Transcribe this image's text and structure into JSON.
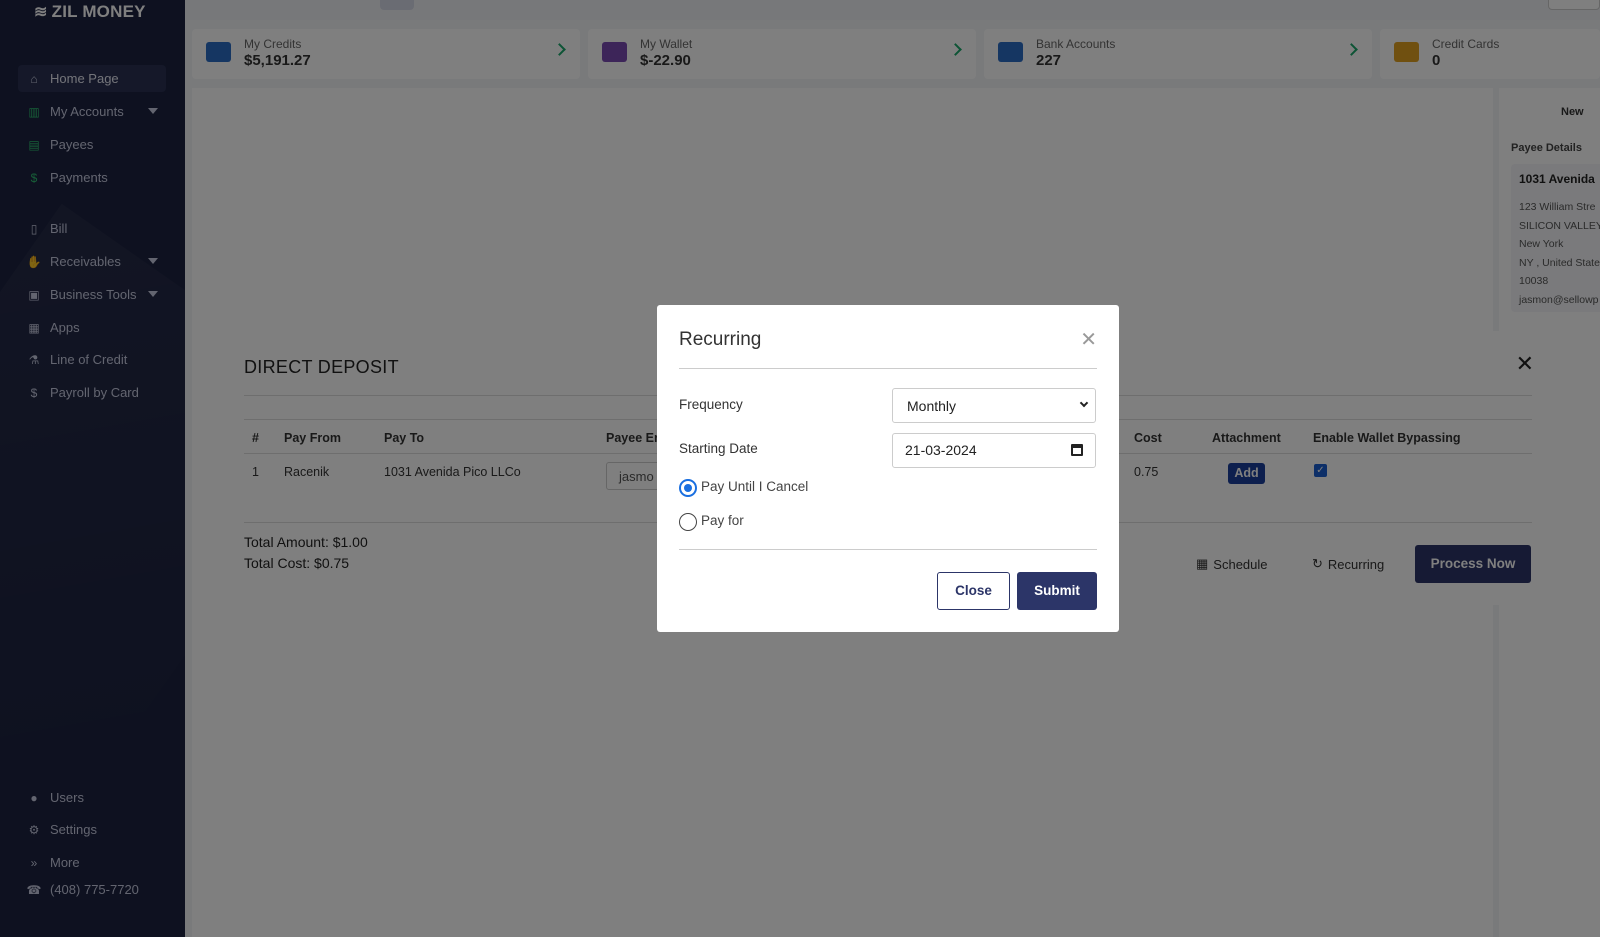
{
  "brand": {
    "name": "ZIL MONEY"
  },
  "sidebar": {
    "items": [
      {
        "label": "Home Page",
        "icon": "home-icon"
      },
      {
        "label": "My Accounts",
        "icon": "bank-icon"
      },
      {
        "label": "Payees",
        "icon": "contact-book-icon"
      },
      {
        "label": "Payments",
        "icon": "dollar-icon"
      },
      {
        "label": "Bill",
        "icon": "bill-icon"
      },
      {
        "label": "Receivables",
        "icon": "hand-coin-icon"
      },
      {
        "label": "Business Tools",
        "icon": "briefcase-icon"
      },
      {
        "label": "Apps",
        "icon": "grid-icon"
      },
      {
        "label": "Line of Credit",
        "icon": "flask-icon"
      },
      {
        "label": "Payroll by Card",
        "icon": "dollar-icon"
      }
    ],
    "bottom": [
      {
        "label": "Users",
        "icon": "user-icon"
      },
      {
        "label": "Settings",
        "icon": "gear-icon"
      },
      {
        "label": "More",
        "icon": "double-chevron-icon"
      },
      {
        "label": "(408) 775-7720",
        "icon": "phone-icon"
      }
    ]
  },
  "cards": [
    {
      "label": "My Credits",
      "value": "$5,191.27",
      "color": "#2b6cc4"
    },
    {
      "label": "My Wallet",
      "value": "$-22.90",
      "color": "#7b4bb3"
    },
    {
      "label": "Bank Accounts",
      "value": "227",
      "color": "#2b6cc4"
    },
    {
      "label": "Credit Cards",
      "value": "0",
      "color": "#e0a020"
    }
  ],
  "right_pane": {
    "new_label": "New",
    "title": "Payee Details",
    "name": "1031 Avenida",
    "lines": [
      "123 William Stre",
      "SILICON VALLEY",
      "New York",
      "NY , United State",
      "10038",
      "jasmon@sellowp"
    ]
  },
  "direct_deposit": {
    "title": "DIRECT DEPOSIT",
    "columns": [
      "#",
      "Pay From",
      "Pay To",
      "Payee Er",
      "Cost",
      "Attachment",
      "Enable Wallet Bypassing"
    ],
    "row": {
      "num": "1",
      "pay_from": "Racenik",
      "pay_to": "1031 Avenida Pico LLCo",
      "payee_email": "jasmo",
      "cost": "0.75",
      "attachment_button": "Add"
    },
    "total_amount": "Total Amount: $1.00",
    "total_cost": "Total Cost: $0.75",
    "schedule_label": "Schedule",
    "recurring_label": "Recurring",
    "process_label": "Process Now"
  },
  "modal": {
    "title": "Recurring",
    "frequency_label": "Frequency",
    "frequency_value": "Monthly",
    "start_label": "Starting Date",
    "start_value": "21-03-2024",
    "radio1": "Pay Until I Cancel",
    "radio2": "Pay for",
    "close_label": "Close",
    "submit_label": "Submit"
  }
}
